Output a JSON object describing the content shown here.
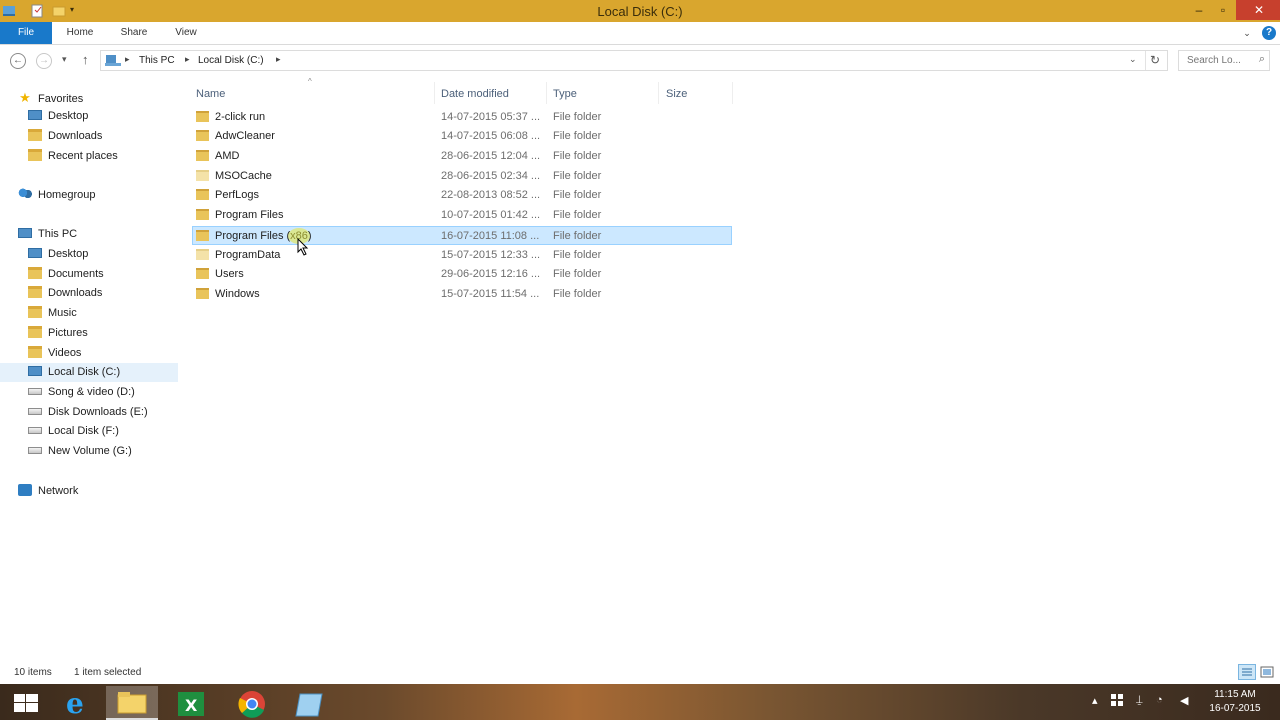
{
  "window": {
    "title": "Local Disk (C:)",
    "accent": "#d9a62e"
  },
  "ribbon": {
    "tabs": [
      "File",
      "Home",
      "Share",
      "View"
    ]
  },
  "address": {
    "crumbs": [
      "This PC",
      "Local Disk (C:)"
    ],
    "search_placeholder": "Search Lo..."
  },
  "nav": {
    "favorites": {
      "label": "Favorites",
      "items": [
        "Desktop",
        "Downloads",
        "Recent places"
      ]
    },
    "homegroup": "Homegroup",
    "thispc": {
      "label": "This PC",
      "items": [
        "Desktop",
        "Documents",
        "Downloads",
        "Music",
        "Pictures",
        "Videos",
        "Local Disk (C:)",
        "Song & video (D:)",
        "Disk Downloads (E:)",
        "Local Disk (F:)",
        "New Volume (G:)"
      ]
    },
    "network": "Network",
    "selected": "Local Disk (C:)"
  },
  "columns": {
    "name": "Name",
    "date": "Date modified",
    "type": "Type",
    "size": "Size"
  },
  "files": [
    {
      "name": "2-click run",
      "date": "14-07-2015 05:37 ...",
      "type": "File folder"
    },
    {
      "name": "AdwCleaner",
      "date": "14-07-2015 06:08 ...",
      "type": "File folder"
    },
    {
      "name": "AMD",
      "date": "28-06-2015 12:04 ...",
      "type": "File folder"
    },
    {
      "name": "MSOCache",
      "date": "28-06-2015 02:34 ...",
      "type": "File folder"
    },
    {
      "name": "PerfLogs",
      "date": "22-08-2013 08:52 ...",
      "type": "File folder"
    },
    {
      "name": "Program Files",
      "date": "10-07-2015 01:42 ...",
      "type": "File folder"
    },
    {
      "name": "Program Files (x86)",
      "date": "16-07-2015 11:08 ...",
      "type": "File folder"
    },
    {
      "name": "ProgramData",
      "date": "15-07-2015 12:33 ...",
      "type": "File folder"
    },
    {
      "name": "Users",
      "date": "29-06-2015 12:16 ...",
      "type": "File folder"
    },
    {
      "name": "Windows",
      "date": "15-07-2015 11:54 ...",
      "type": "File folder"
    }
  ],
  "selected_file": "Program Files (x86)",
  "status": {
    "count": "10 items",
    "selection": "1 item selected"
  },
  "clock": {
    "time": "11:15 AM",
    "date": "16-07-2015"
  }
}
